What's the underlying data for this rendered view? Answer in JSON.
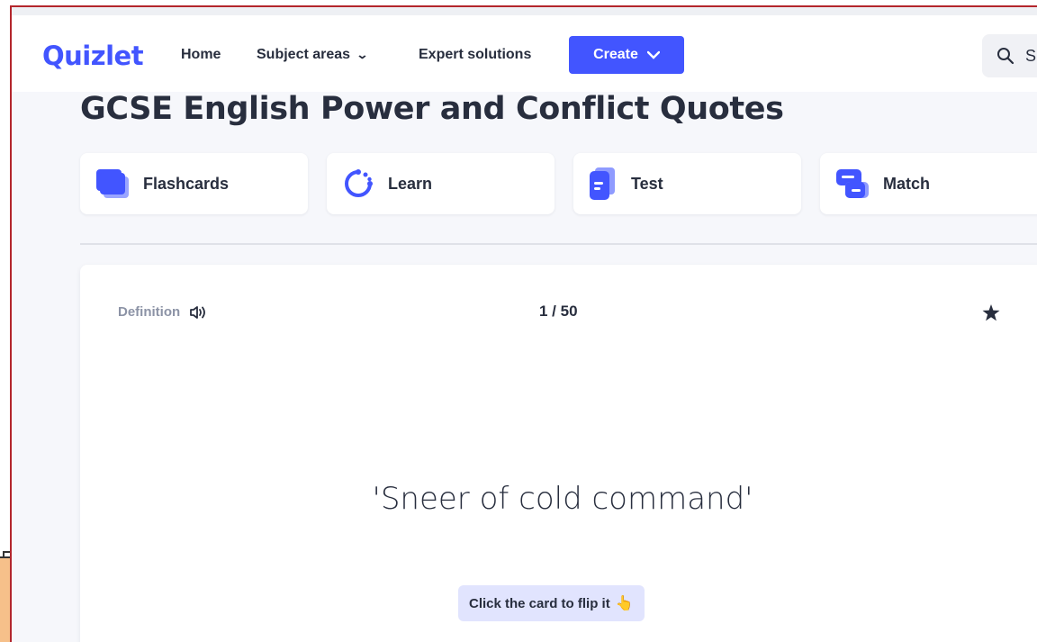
{
  "nav": {
    "logo": "Quizlet",
    "home": "Home",
    "subject_areas": "Subject areas",
    "expert_solutions": "Expert solutions",
    "create": "Create",
    "search_placeholder": "S"
  },
  "set": {
    "title": "GCSE English Power and Conflict Quotes"
  },
  "modes": [
    {
      "label": "Flashcards",
      "icon": "flashcards-icon"
    },
    {
      "label": "Learn",
      "icon": "learn-icon"
    },
    {
      "label": "Test",
      "icon": "test-icon"
    },
    {
      "label": "Match",
      "icon": "match-icon"
    }
  ],
  "card": {
    "side_label": "Definition",
    "counter": "1 / 50",
    "term": "'Sneer of cold command'",
    "flip_hint": "Click the card to flip it",
    "hint_emoji": "👆"
  },
  "colors": {
    "brand": "#4255ff",
    "text": "#282e3e",
    "muted": "#8c93a6",
    "hint_bg": "#e1e4fe"
  }
}
